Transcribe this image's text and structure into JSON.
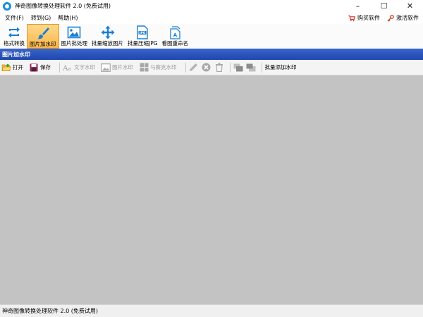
{
  "window": {
    "title": "神奇图像转换处理软件 2.0 (免费试用)",
    "controls": {
      "minimize": "–",
      "maximize": "☐",
      "close": "✕"
    }
  },
  "menu": {
    "items": [
      {
        "label": "文件(F)"
      },
      {
        "label": "转到(G)"
      },
      {
        "label": "帮助(H)"
      }
    ],
    "buy": "购买软件",
    "activate": "激活软件"
  },
  "toolbar": {
    "items": [
      {
        "label": "格式转换",
        "icon": "convert-arrows-icon",
        "active": false
      },
      {
        "label": "图片加水印",
        "icon": "brush-icon",
        "active": true
      },
      {
        "label": "图片批处理",
        "icon": "image-icon",
        "active": false
      },
      {
        "label": "批量缩放图片",
        "icon": "move-arrows-icon",
        "active": false
      },
      {
        "label": "批量压缩JPG",
        "icon": "jpg-file-icon",
        "active": false
      },
      {
        "label": "看图重命名",
        "icon": "rename-icon",
        "active": false
      }
    ]
  },
  "panel": {
    "title": "图片加水印"
  },
  "subtoolbar": {
    "open": "打开",
    "save": "保存",
    "text_watermark": "文字水印",
    "image_watermark": "图片水印",
    "mosaic_watermark": "马赛克水印",
    "batch_add": "批量添加水印"
  },
  "status": {
    "text": "神奇图像转换处理软件 2.0 (免费试用)"
  },
  "colors": {
    "header_blue": "#2550b8",
    "active_tab": "#f9c25a",
    "workspace": "#c3c3c3",
    "icon_blue": "#1a7fd4"
  }
}
